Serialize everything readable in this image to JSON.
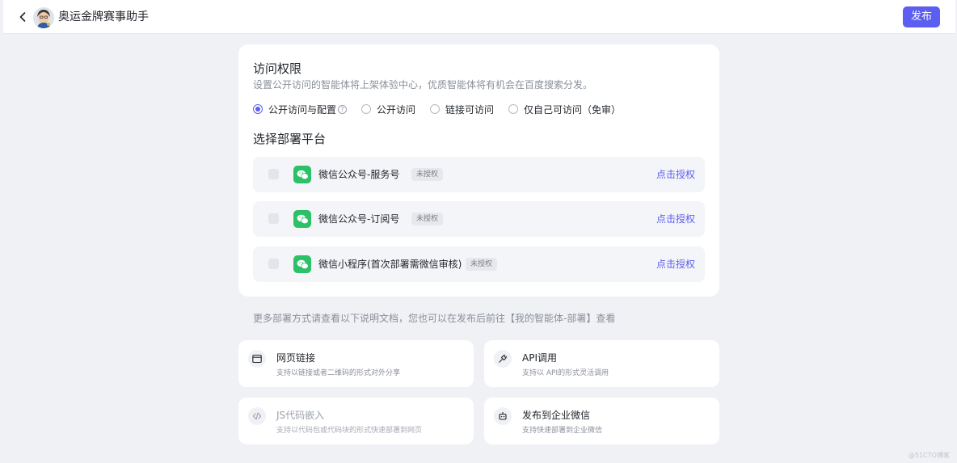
{
  "header": {
    "title": "奥运金牌赛事助手",
    "publish_label": "发布"
  },
  "access": {
    "title": "访问权限",
    "description": "设置公开访问的智能体将上架体验中心，优质智能体将有机会在百度搜索分发。",
    "options": [
      {
        "label": "公开访问与配置",
        "selected": true
      },
      {
        "label": "公开访问",
        "selected": false
      },
      {
        "label": "链接可访问",
        "selected": false
      },
      {
        "label": "仅自己可访问（免审）",
        "selected": false
      }
    ]
  },
  "platforms": {
    "title": "选择部署平台",
    "items": [
      {
        "name": "微信公众号-服务号",
        "badge": "未授权",
        "action": "点击授权",
        "icon": "wechat-icon"
      },
      {
        "name": "微信公众号-订阅号",
        "badge": "未授权",
        "action": "点击授权",
        "icon": "wechat-icon"
      },
      {
        "name": "微信小程序(首次部署需微信审核)",
        "badge": "未授权",
        "action": "点击授权",
        "icon": "wechat-icon"
      }
    ]
  },
  "more_text": "更多部署方式请查看以下说明文档，您也可以在发布后前往【我的智能体-部署】查看",
  "deploy_ways": [
    {
      "title": "网页链接",
      "desc": "支持以链接或者二维码的形式对外分享",
      "icon": "browser-window-icon",
      "disabled": false
    },
    {
      "title": "API调用",
      "desc": "支持以 API的形式灵活调用",
      "icon": "plug-icon",
      "disabled": false
    },
    {
      "title": "JS代码嵌入",
      "desc": "支持以代码包或代码块的形式快速部署到网页",
      "icon": "code-icon",
      "disabled": true
    },
    {
      "title": "发布到企业微信",
      "desc": "支持快速部署到企业微信",
      "icon": "robot-icon",
      "disabled": false
    }
  ],
  "watermark": "@51CTO博客",
  "colors": {
    "accent": "#5b5ef0",
    "wechat": "#2cc168",
    "background": "#f0f1f5"
  }
}
